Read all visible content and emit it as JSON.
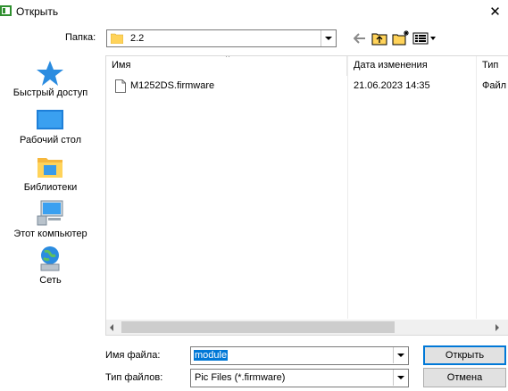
{
  "window": {
    "title": "Открыть",
    "close_glyph": "✕"
  },
  "toolbar": {
    "look_in_label": "Папка:",
    "look_in_value": "2.2",
    "icons": [
      "back-arrow-icon",
      "up-folder-icon",
      "new-folder-icon",
      "view-menu-icon"
    ]
  },
  "places": [
    {
      "label": "Быстрый доступ",
      "icon": "quick-access-star-icon"
    },
    {
      "label": "Рабочий стол",
      "icon": "desktop-icon"
    },
    {
      "label": "Библиотеки",
      "icon": "libraries-icon"
    },
    {
      "label": "Этот компьютер",
      "icon": "computer-icon"
    },
    {
      "label": "Сеть",
      "icon": "network-icon"
    }
  ],
  "columns": {
    "name": "Имя",
    "date": "Дата изменения",
    "type": "Тип"
  },
  "files": [
    {
      "name": "M1252DS.firmware",
      "date": "21.06.2023 14:35",
      "type": "Файл"
    }
  ],
  "footer": {
    "file_name_label": "Имя файла:",
    "file_name_value": "module",
    "file_type_label": "Тип файлов:",
    "file_type_value": "Pic Files (*.firmware)",
    "open_label": "Открыть",
    "cancel_label": "Отмена"
  },
  "colors": {
    "accent": "#0078d7",
    "folder": "#ffd35a",
    "button": "#e1e1e1"
  }
}
